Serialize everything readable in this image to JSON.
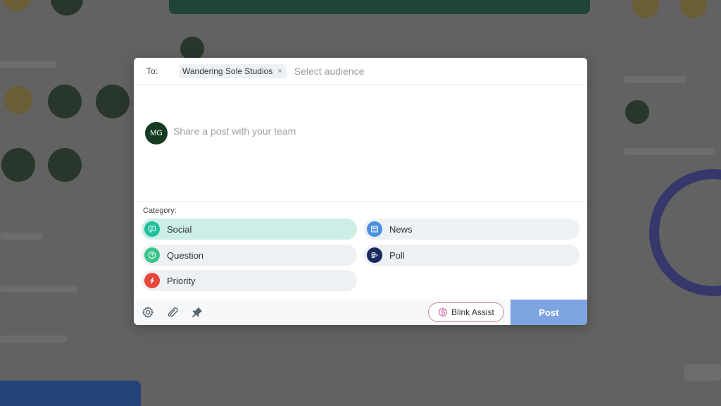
{
  "composer": {
    "to_label": "To:",
    "recipient_chip": "Wandering Sole Studios",
    "chip_remove": "×",
    "audience_placeholder": "Select audience",
    "avatar_initials": "MG",
    "post_placeholder": "Share a post with your team"
  },
  "categories": {
    "label": "Category:",
    "items": [
      {
        "label": "Social",
        "icon": "chat-bubble-icon",
        "color": "#1fbf9a",
        "selected": true
      },
      {
        "label": "News",
        "icon": "newspaper-icon",
        "color": "#4a90e2",
        "selected": false
      },
      {
        "label": "Question",
        "icon": "question-circle-icon",
        "color": "#3cc48a",
        "selected": false
      },
      {
        "label": "Poll",
        "icon": "poll-bars-icon",
        "color": "#1a2a5e",
        "selected": false
      },
      {
        "label": "Priority",
        "icon": "lightning-icon",
        "color": "#e5473b",
        "selected": false
      }
    ]
  },
  "footer": {
    "blink_label": "Blink Assist",
    "post_label": "Post"
  },
  "colors": {
    "accent_selected": "#cdeee6",
    "post_button": "#7fa4e2",
    "avatar_bg": "#163a22"
  }
}
